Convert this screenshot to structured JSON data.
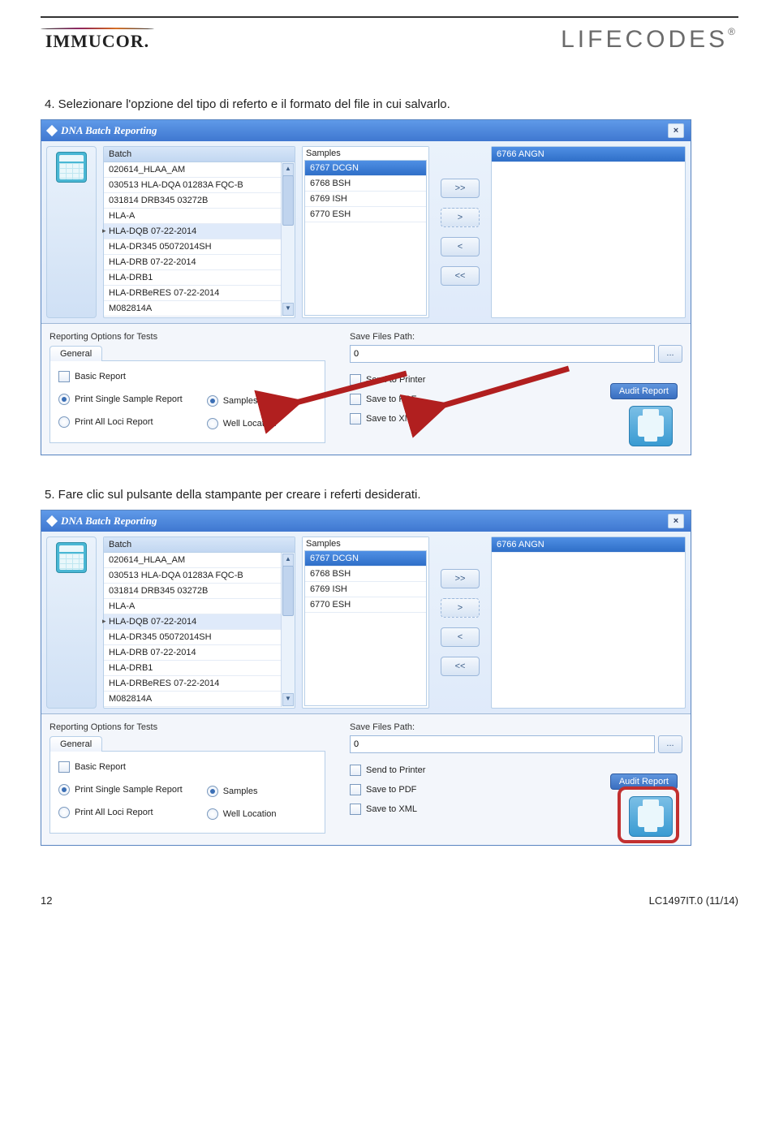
{
  "header": {
    "logo_left": "IMMUCOR.",
    "logo_right": "LIFECODES",
    "logo_right_sup": "®"
  },
  "steps": {
    "s4": "4.  Selezionare l'opzione del tipo di referto e il formato del file in cui salvarlo.",
    "s5": "5.  Fare clic sul pulsante della stampante per creare i referti desiderati."
  },
  "dialog": {
    "title": "DNA Batch Reporting",
    "close": "×",
    "batch_header": "Batch",
    "batch_items": [
      "020614_HLAA_AM",
      "030513 HLA-DQA 01283A FQC-B",
      "031814 DRB345 03272B",
      "HLA-A",
      "HLA-DQB 07-22-2014",
      "HLA-DR345 05072014SH",
      "HLA-DRB 07-22-2014",
      "HLA-DRB1",
      "HLA-DRBeRES 07-22-2014",
      "M082814A"
    ],
    "samples_header": "Samples",
    "samples_items": [
      "6767 DCGN",
      "6768 BSH",
      "6769 ISH",
      "6770 ESH"
    ],
    "move": {
      "all_r": ">>",
      "one_r": ">",
      "one_l": "<",
      "all_l": "<<"
    },
    "selected_items": [
      "6766 ANGN"
    ],
    "reporting_label": "Reporting Options for Tests",
    "tab_general": "General",
    "opts": {
      "basic": "Basic Report",
      "print_single": "Print Single Sample Report",
      "print_all": "Print All Loci Report",
      "samples": "Samples",
      "well": "Well Location"
    },
    "save_path_label": "Save Files Path:",
    "save_path_value": "0",
    "browse": "...",
    "save_opts": {
      "printer": "Send to Printer",
      "pdf": "Save to PDF",
      "xml": "Save to XML"
    },
    "audit": "Audit Report"
  },
  "footer": {
    "page": "12",
    "code": "LC1497IT.0 (11/14)"
  }
}
